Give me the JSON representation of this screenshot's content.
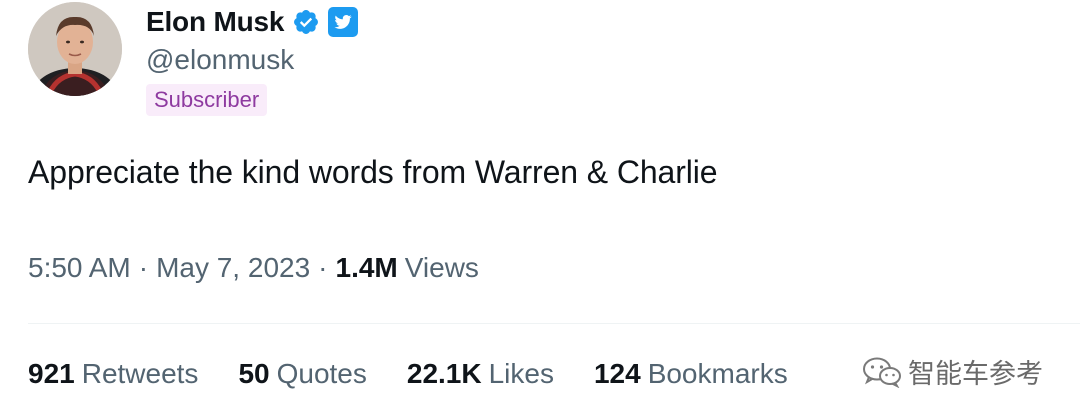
{
  "author": {
    "display_name": "Elon Musk",
    "handle": "@elonmusk",
    "badge": "Subscriber",
    "verified_icon": "verified-badge-icon",
    "platform_icon": "twitter-bird-icon"
  },
  "tweet": {
    "text": "Appreciate the kind words from Warren & Charlie"
  },
  "meta": {
    "time": "5:50 AM",
    "separator": "·",
    "date": "May 7, 2023",
    "views_count": "1.4M",
    "views_label": "Views"
  },
  "stats": [
    {
      "count": "921",
      "label": "Retweets"
    },
    {
      "count": "50",
      "label": "Quotes"
    },
    {
      "count": "22.1K",
      "label": "Likes"
    },
    {
      "count": "124",
      "label": "Bookmarks"
    }
  ],
  "watermark": {
    "text": "智能车参考",
    "icon": "wechat-icon"
  },
  "colors": {
    "text_primary": "#0f1419",
    "text_secondary": "#536471",
    "verified_blue": "#1d9bf0",
    "badge_bg": "#f9ecfa",
    "badge_text": "#8e3aa0"
  }
}
